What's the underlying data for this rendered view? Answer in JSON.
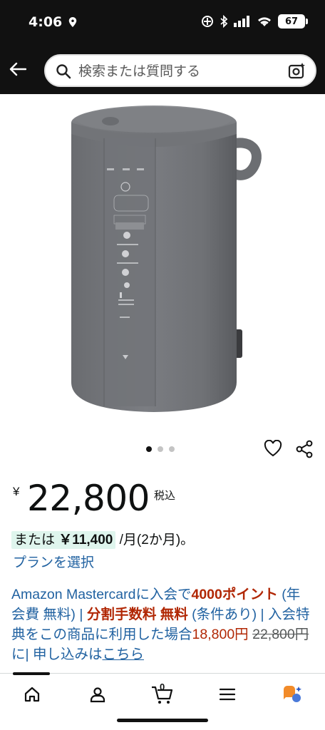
{
  "status_bar": {
    "time": "4:06",
    "battery": "67"
  },
  "search": {
    "placeholder": "検索または質問する"
  },
  "product": {
    "image_alt": "ZOJIRUSHI スチーム式加湿器"
  },
  "carousel": {
    "dot_count": 3,
    "active_index": 0
  },
  "price": {
    "currency_symbol": "¥",
    "value": "22,800",
    "tax_label": "税込"
  },
  "installment": {
    "prefix": "または",
    "amount": "￥11,400",
    "suffix": "/月(2か月)。",
    "plan_link": "プランを選択"
  },
  "promo": {
    "t1": "Amazon Mastercardに入会で",
    "t2": "4000ポイント",
    "t3": " (年会費 無料) | ",
    "t4": "分割手数料 無料",
    "t5": " (条件あり) | 入会特典をこの商品に利用した場合",
    "t6": "18,800円",
    "t7": " ",
    "t8": "22,800円",
    "t9": "に| 申し込みは",
    "t10": "こちら"
  },
  "bottom_nav": {
    "items": [
      "home-icon",
      "account-icon",
      "cart-icon",
      "menu-icon",
      "rufus-icon"
    ],
    "cart_count": "0"
  },
  "colors": {
    "header_bg": "#111111",
    "link": "#2162A1",
    "price_red": "#B12704",
    "installment_bg": "#dff5ed"
  }
}
